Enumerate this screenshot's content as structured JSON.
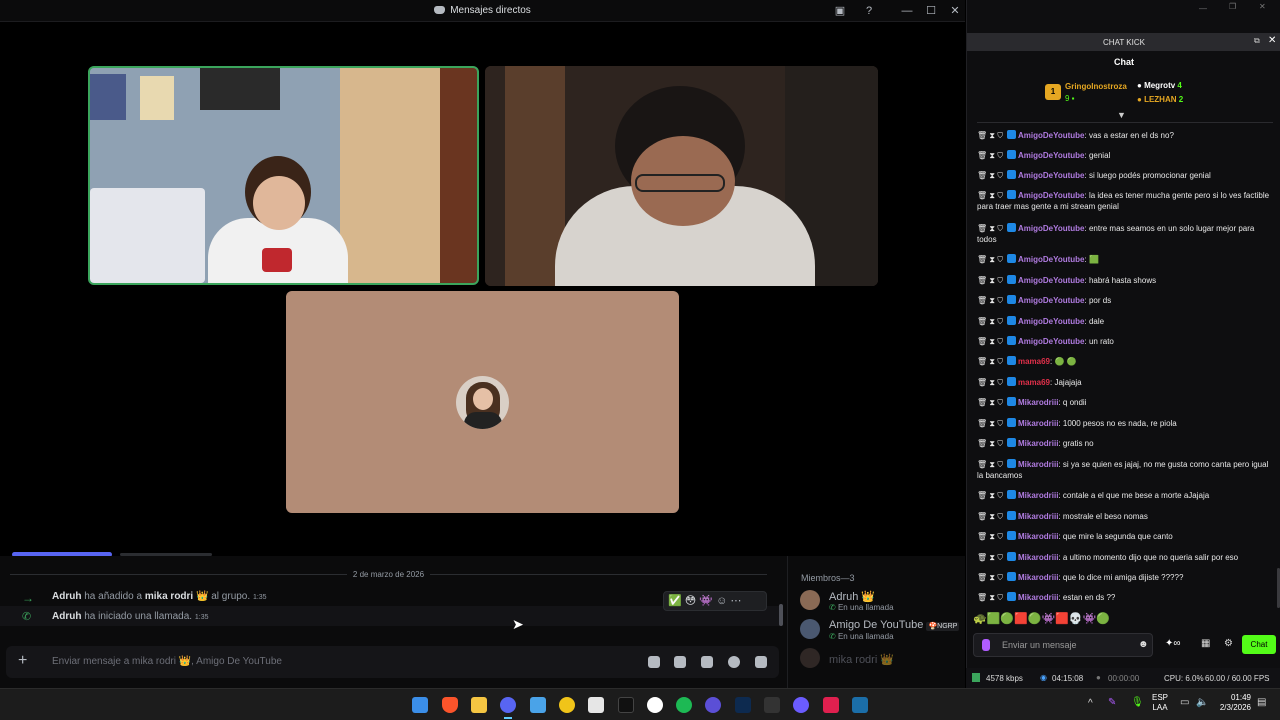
{
  "discord": {
    "window_title": "Mensajes directos",
    "date_divider": "2 de marzo de 2026",
    "system_messages": [
      {
        "actor": "Adruh",
        "text_a": "ha añadido a",
        "target": "mika rodri",
        "text_b": "al grupo.",
        "time": "1:35"
      },
      {
        "actor": "Adruh",
        "text_a": "ha iniciado una llamada.",
        "target": "",
        "text_b": "",
        "time": "1:35"
      }
    ],
    "message_placeholder": "Enviar mensaje a mika rodri 👑, Amigo De YouTube",
    "members_header": "Miembros—3",
    "members": [
      {
        "name": "Adruh",
        "status": "En una llamada",
        "badge": "👑",
        "tag": ""
      },
      {
        "name": "Amigo De YouTube",
        "status": "En una llamada",
        "badge": "",
        "tag": "NGRP"
      },
      {
        "name": "mika rodri",
        "status": "",
        "badge": "👑",
        "tag": ""
      }
    ],
    "reactions": [
      "✅",
      "😳",
      "👾"
    ]
  },
  "kick": {
    "panel_title": "CHAT KICK",
    "tab": "Chat",
    "leaderboard": [
      {
        "rank": "1",
        "name": "GringoInostroza",
        "count": "9"
      },
      {
        "rank": "",
        "name": "Megrotv",
        "count": "4"
      },
      {
        "rank": "",
        "name": "LEZHAN",
        "count": "2"
      }
    ],
    "messages": [
      {
        "user": "AmigoDeYoutube",
        "color": "#b07be0",
        "text": "vas a estar en el ds no?"
      },
      {
        "user": "AmigoDeYoutube",
        "color": "#b07be0",
        "text": "genial"
      },
      {
        "user": "AmigoDeYoutube",
        "color": "#b07be0",
        "text": "si luego podés promocionar genial"
      },
      {
        "user": "AmigoDeYoutube",
        "color": "#b07be0",
        "text": "la idea es tener mucha gente pero si lo ves factible para traer mas gente a mi stream genial"
      },
      {
        "user": "AmigoDeYoutube",
        "color": "#b07be0",
        "text": "entre mas seamos en un solo lugar mejor para todos"
      },
      {
        "user": "AmigoDeYoutube",
        "color": "#b07be0",
        "text": "🟩"
      },
      {
        "user": "AmigoDeYoutube",
        "color": "#b07be0",
        "text": "habrá hasta shows"
      },
      {
        "user": "AmigoDeYoutube",
        "color": "#b07be0",
        "text": "por ds"
      },
      {
        "user": "AmigoDeYoutube",
        "color": "#b07be0",
        "text": "dale"
      },
      {
        "user": "AmigoDeYoutube",
        "color": "#b07be0",
        "text": "un rato"
      },
      {
        "user": "mama69",
        "color": "#e0304a",
        "text": "🟢 🟢"
      },
      {
        "user": "mama69",
        "color": "#e0304a",
        "text": "Jajajaja"
      },
      {
        "user": "Mikarodriii",
        "color": "#b07be0",
        "text": "q ondii"
      },
      {
        "user": "Mikarodriii",
        "color": "#b07be0",
        "text": "1000 pesos no es nada, re piola"
      },
      {
        "user": "Mikarodriii",
        "color": "#b07be0",
        "text": "gratis no"
      },
      {
        "user": "Mikarodriii",
        "color": "#b07be0",
        "text": "si ya se quien es jajaj, no me gusta como canta pero igual la bancamos"
      },
      {
        "user": "Mikarodriii",
        "color": "#b07be0",
        "text": "contale a el que me bese a morte aJajaja"
      },
      {
        "user": "Mikarodriii",
        "color": "#b07be0",
        "text": "mostrale el beso nomas"
      },
      {
        "user": "Mikarodriii",
        "color": "#b07be0",
        "text": "que mire la segunda que canto"
      },
      {
        "user": "Mikarodriii",
        "color": "#b07be0",
        "text": "a ultimo momento dijo que no queria salir por eso"
      },
      {
        "user": "Mikarodriii",
        "color": "#b07be0",
        "text": "que lo dice mi amiga dijiste ?????"
      },
      {
        "user": "Mikarodriii",
        "color": "#b07be0",
        "text": "estan en ds ??"
      }
    ],
    "input_placeholder": "Enviar un mensaje",
    "chat_button": "Chat",
    "stats": {
      "kbps": "4578 kbps",
      "uptime": "04:15:08",
      "rec": "00:00:00",
      "cpu": "CPU: 6.0%",
      "fps": "60.00 / 60.00 FPS"
    }
  },
  "taskbar": {
    "lang": "ESP",
    "lang2": "LAA",
    "time": "01:49",
    "date": "2/3/2026"
  }
}
